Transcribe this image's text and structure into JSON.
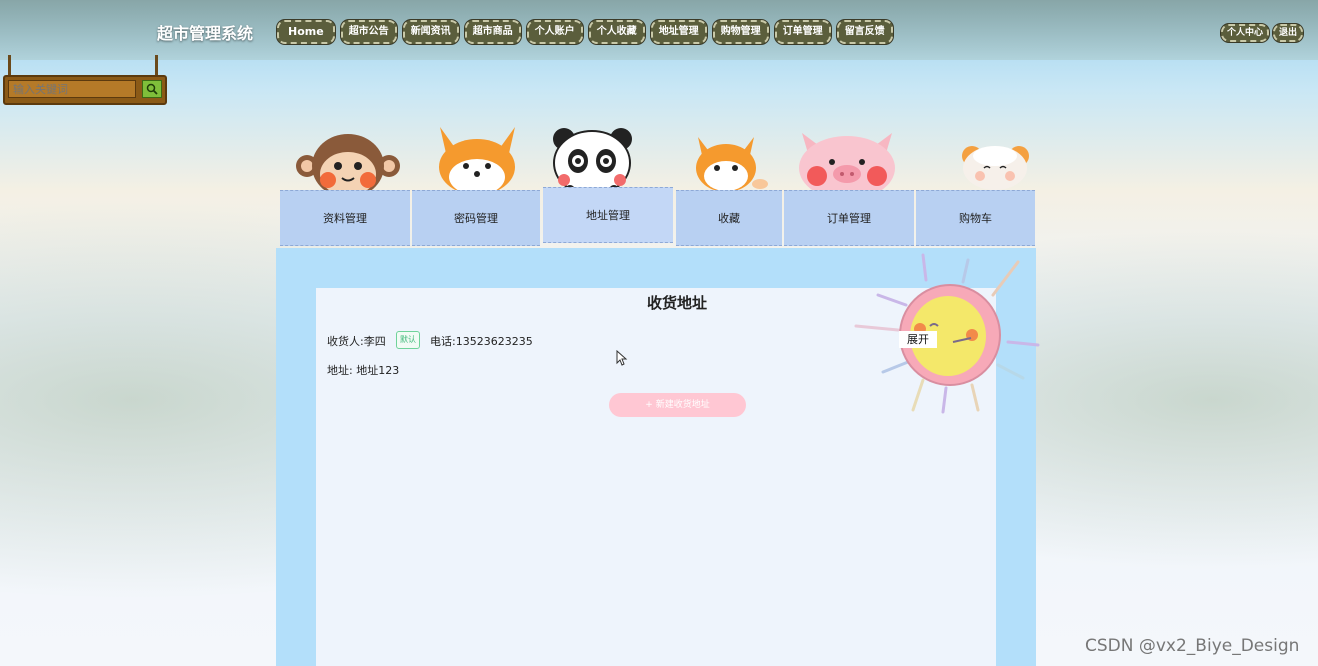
{
  "header": {
    "site_title": "超市管理系统",
    "nav": [
      "Home",
      "超市公告",
      "新闻资讯",
      "超市商品",
      "个人账户",
      "个人收藏",
      "地址管理",
      "购物管理",
      "订单管理",
      "留言反馈"
    ],
    "right_nav": [
      "个人中心",
      "退出"
    ]
  },
  "search": {
    "placeholder": "输入关键词"
  },
  "tabs": [
    "资料管理",
    "密码管理",
    "地址管理",
    "收藏",
    "订单管理",
    "购物车"
  ],
  "active_tab": "地址管理",
  "panel": {
    "title": "收货地址",
    "recipient": "收货人:李四",
    "default_badge": "默认",
    "phone": "电话:13523623235",
    "address": "地址: 地址123",
    "new_address_button": "+ 新建收货地址",
    "expand_button": "展开"
  },
  "watermark": "CSDN @vx2_Biye_Design",
  "colors": {
    "panel_border": "#b3dffa",
    "tab_bg": "#b8d0f2",
    "new_button": "#ffc7d3",
    "badge_green": "#3fb97a"
  }
}
